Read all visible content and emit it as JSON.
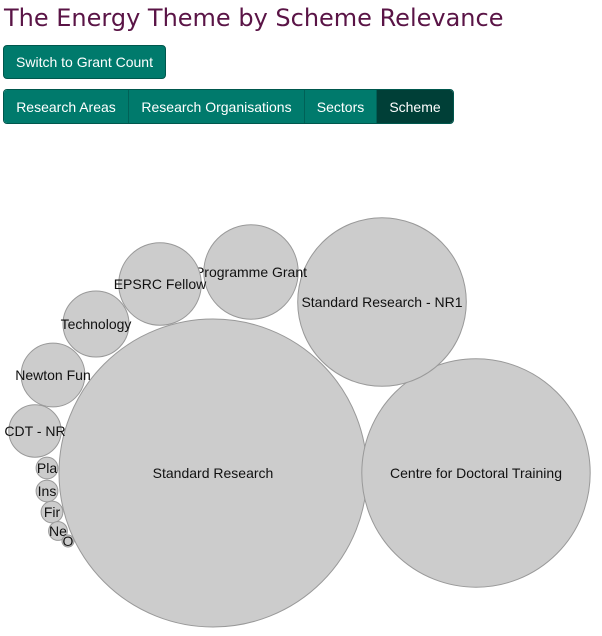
{
  "title": "The Energy Theme by Scheme Relevance",
  "switch_button_label": "Switch to Grant Count",
  "tabs": [
    {
      "label": "Research Areas",
      "active": false
    },
    {
      "label": "Research Organisations",
      "active": false
    },
    {
      "label": "Sectors",
      "active": false
    },
    {
      "label": "Scheme",
      "active": true
    }
  ],
  "colors": {
    "title": "#5a1446",
    "button": "#007a6c",
    "button_active": "#003f37",
    "bubble_fill": "#cccccc",
    "bubble_stroke": "#999999"
  },
  "chart_data": {
    "type": "bubble",
    "title": "The Energy Theme by Scheme Relevance",
    "bubbles": [
      {
        "label": "Standard Research",
        "relative_size": 1.0
      },
      {
        "label": "Centre for Doctoral Training",
        "relative_size": 0.55
      },
      {
        "label": "Standard Research - NR1",
        "relative_size": 0.3
      },
      {
        "label": "Programme Grant",
        "relative_size": 0.094
      },
      {
        "label": "EPSRC Fellow",
        "relative_size": 0.072
      },
      {
        "label": "Technology",
        "relative_size": 0.046
      },
      {
        "label": "Newton Fun",
        "relative_size": 0.043
      },
      {
        "label": "CDT - NR",
        "relative_size": 0.029
      },
      {
        "label": "Pla",
        "relative_size": 0.005
      },
      {
        "label": "Ins",
        "relative_size": 0.005
      },
      {
        "label": "Fir",
        "relative_size": 0.005
      },
      {
        "label": "Ne",
        "relative_size": 0.0037
      },
      {
        "label": "O",
        "relative_size": 0.0015
      }
    ]
  }
}
